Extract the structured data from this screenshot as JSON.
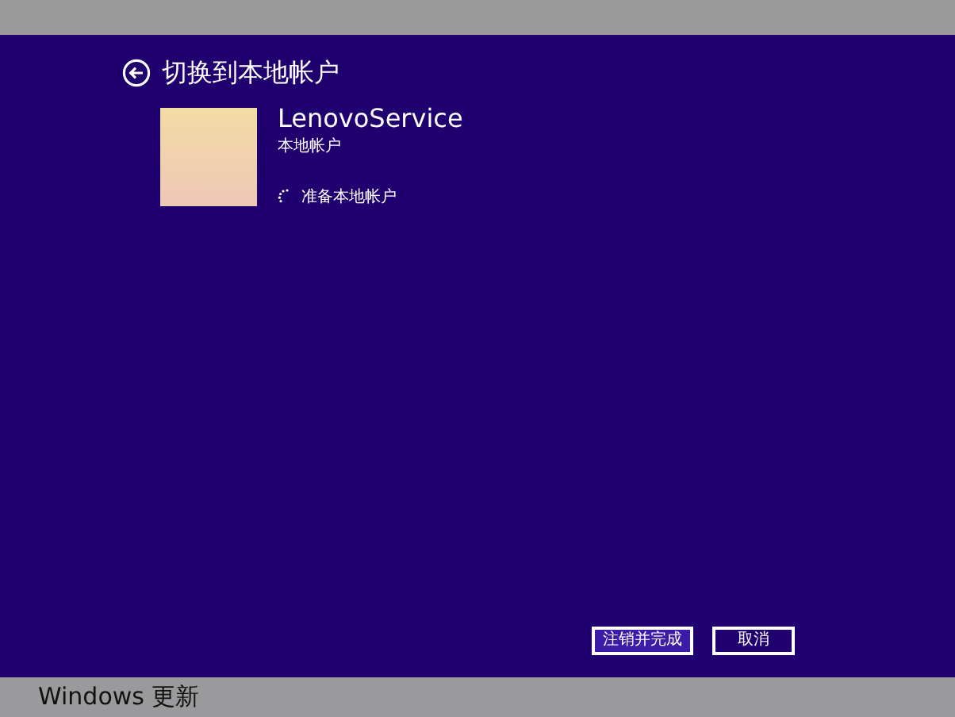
{
  "page": {
    "title": "切换到本地帐户"
  },
  "account": {
    "name": "LenovoService",
    "type": "本地帐户",
    "status": "准备本地帐户"
  },
  "buttons": [
    {
      "label": "注销并完成",
      "selected": true
    },
    {
      "label": "取消",
      "selected": false
    }
  ],
  "taskbar": {
    "label": "Windows 更新"
  }
}
